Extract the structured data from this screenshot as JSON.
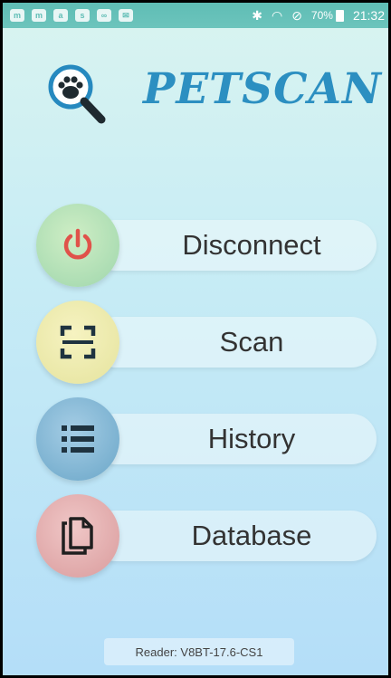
{
  "status_bar": {
    "left_icons": [
      "m",
      "m",
      "a",
      "s",
      "vm",
      "mail"
    ],
    "percent": "70%",
    "time": "21:32"
  },
  "header": {
    "title": "PETSCAN",
    "title_color": "#2c8fc1",
    "logo_icon": "paw-magnifier-icon"
  },
  "menu": [
    {
      "label": "Disconnect",
      "icon": "power-icon",
      "icon_color": "#e0524a",
      "circle_color": "#a9dbb1"
    },
    {
      "label": "Scan",
      "icon": "scan-frame-icon",
      "icon_color": "#1f3340",
      "circle_color": "#ebe8a8"
    },
    {
      "label": "History",
      "icon": "list-icon",
      "icon_color": "#1f3340",
      "circle_color": "#7bb2d2"
    },
    {
      "label": "Database",
      "icon": "copy-documents-icon",
      "icon_color": "#1f1f1f",
      "circle_color": "#e1a9a9"
    }
  ],
  "footer": {
    "reader_text": "Reader: V8BT-17.6-CS1"
  }
}
